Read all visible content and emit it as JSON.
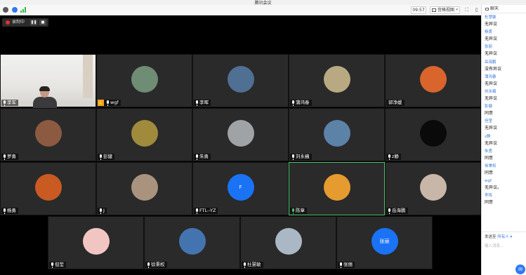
{
  "window": {
    "title": "腾讯会议"
  },
  "toolbar": {
    "time": "09:57",
    "view_label": "宫格视图",
    "colors": {
      "signal": "#2bbc4a",
      "shield": "#2f7bf0"
    }
  },
  "recording": {
    "label": "录制中",
    "pause_icon": "pause-icon",
    "stop_icon": "stop-icon"
  },
  "participants": [
    {
      "name": "李军",
      "type": "video"
    },
    {
      "name": "wgf",
      "type": "avatar",
      "hand": "✋",
      "color": "#6f8c74"
    },
    {
      "name": "李晖",
      "type": "avatar",
      "color": "#4f6f93"
    },
    {
      "name": "蒲鸿春",
      "type": "avatar",
      "color": "#b9a982"
    },
    {
      "name": "郭净媛",
      "type": "avatar",
      "no_mic": true,
      "color": "#d9642c"
    },
    {
      "name": "罗勇",
      "type": "avatar",
      "color": "#8c5a41"
    },
    {
      "name": "彭健",
      "type": "avatar",
      "color": "#a08a3c"
    },
    {
      "name": "朱勇",
      "type": "avatar",
      "color": "#9fa3a6"
    },
    {
      "name": "刘永巍",
      "type": "avatar",
      "color": "#5d82a8"
    },
    {
      "name": "z静",
      "type": "avatar",
      "color": "#0a0a0a"
    },
    {
      "name": "杨勇",
      "type": "avatar",
      "color": "#c85a22"
    },
    {
      "name": "J",
      "type": "avatar",
      "color": "#a9937f"
    },
    {
      "name": "FTL--YZ",
      "type": "letter",
      "letter": "F",
      "color": "#1a73f5"
    },
    {
      "name": "陈章",
      "type": "avatar",
      "active": true,
      "mic": "green",
      "color": "#e59b2f"
    },
    {
      "name": "岳海鹏",
      "type": "avatar",
      "color": "#c8b7a8"
    },
    {
      "name": "但莹",
      "type": "avatar",
      "color": "#f1c6c2"
    },
    {
      "name": "徐秉权",
      "type": "avatar",
      "color": "#4474b0"
    },
    {
      "name": "杜慧敏",
      "type": "avatar",
      "color": "#a9b8c4"
    },
    {
      "name": "张丽",
      "type": "letter",
      "letter": "张丽",
      "color": "#1a73f5"
    }
  ],
  "chat": {
    "title": "聊天",
    "messages": [
      {
        "from": "杜慧敏",
        "text": "无异议"
      },
      {
        "from": "杨勇",
        "text": "无异议"
      },
      {
        "from": "张丽",
        "text": "无异议"
      },
      {
        "from": "岳海鹏",
        "text": "没有异议"
      },
      {
        "from": "蒲鸿春",
        "text": "无异议"
      },
      {
        "from": "刘永巍",
        "text": "无异议"
      },
      {
        "from": "彭健",
        "text": "同意"
      },
      {
        "from": "但莹",
        "text": "无异议"
      },
      {
        "from": "z静",
        "text": "无异议"
      },
      {
        "from": "朱勇",
        "text": "同意"
      },
      {
        "from": "徐秉权",
        "text": "同意"
      },
      {
        "from": "wgf",
        "text": "无异议。"
      },
      {
        "from": "李晖",
        "text": "同意"
      }
    ],
    "send_to_label": "发送至",
    "send_to_target": "所有人",
    "input_placeholder": "输入消息..."
  }
}
